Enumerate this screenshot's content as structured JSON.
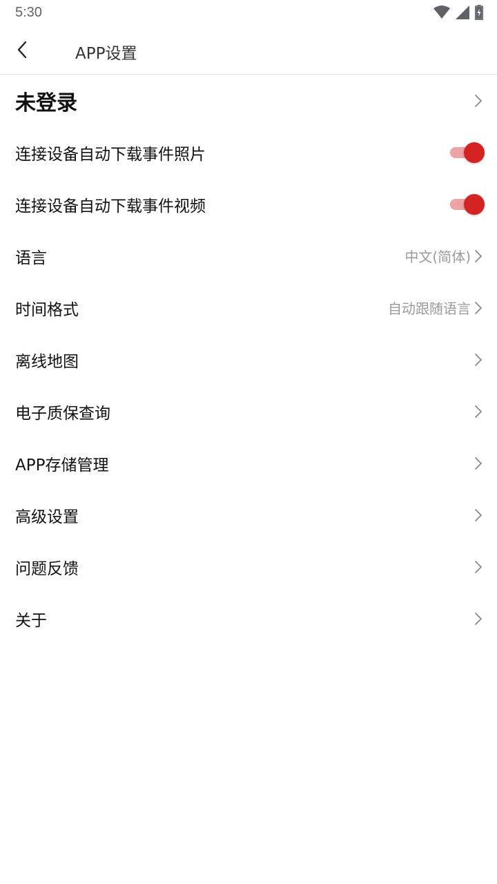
{
  "status_bar": {
    "time": "5:30",
    "icons": [
      "wifi-icon",
      "signal-icon",
      "battery-charging-icon"
    ]
  },
  "header": {
    "back_icon": "chevron-left-icon",
    "title": "APP设置"
  },
  "account": {
    "label": "未登录"
  },
  "toggles": [
    {
      "label": "连接设备自动下载事件照片",
      "on": true
    },
    {
      "label": "连接设备自动下载事件视频",
      "on": true
    }
  ],
  "settings": [
    {
      "label": "语言",
      "value": "中文(简体)"
    },
    {
      "label": "时间格式",
      "value": "自动跟随语言"
    },
    {
      "label": "离线地图",
      "value": ""
    },
    {
      "label": "电子质保查询",
      "value": ""
    },
    {
      "label": "APP存储管理",
      "value": ""
    },
    {
      "label": "高级设置",
      "value": ""
    },
    {
      "label": "问题反馈",
      "value": ""
    },
    {
      "label": "关于",
      "value": ""
    }
  ],
  "colors": {
    "accent": "#d32323",
    "accent_track": "#eda3a3",
    "secondary_text": "#9a9a9a",
    "divider": "#e2e2e2"
  }
}
